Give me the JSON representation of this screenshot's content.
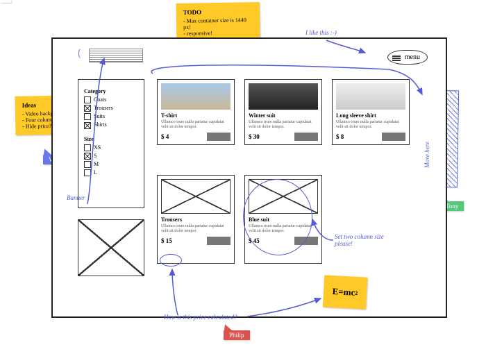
{
  "stickies": {
    "todo": {
      "title": "TODO",
      "items": [
        "Max container size is 1440 px!",
        "responsive!"
      ]
    },
    "ideas": {
      "title": "Ideas",
      "items": [
        "Video background",
        "Four columns grid",
        "Hide price?"
      ]
    }
  },
  "annotations": {
    "like": "I like this :-)",
    "banner": "Banner",
    "move": "Move here",
    "twoCol": "Set two column size please!",
    "priceQ": "How is this price calculated?"
  },
  "users": {
    "victoria": {
      "name": "Victoria",
      "color": "#6a77e8"
    },
    "philip": {
      "name": "Philip",
      "color": "#d9534f"
    },
    "tony": {
      "name": "Tony",
      "color": "#55c779"
    }
  },
  "menu": {
    "label": "menu"
  },
  "filters": {
    "categoryTitle": "Category",
    "categories": [
      {
        "label": "Coats",
        "checked": false
      },
      {
        "label": "Trousers",
        "checked": true
      },
      {
        "label": "Suits",
        "checked": false
      },
      {
        "label": "Shirts",
        "checked": true
      }
    ],
    "sizeTitle": "Size",
    "sizes": [
      {
        "label": "XS",
        "checked": false
      },
      {
        "label": "S",
        "checked": true
      },
      {
        "label": "M",
        "checked": false
      },
      {
        "label": "L",
        "checked": false
      }
    ]
  },
  "lorem": "Ullamco irure nulla pariatur cupidatat velit sit dolor tempor.",
  "products": [
    {
      "name": "T-shirt",
      "price": "$ 4"
    },
    {
      "name": "Winter suit",
      "price": "$ 30"
    },
    {
      "name": "Long sleeve shirt",
      "price": "$ 8"
    },
    {
      "name": "Trousers",
      "price": "$ 15"
    },
    {
      "name": "Blue suit",
      "price": "$ 45"
    }
  ],
  "formula": "E=mc"
}
